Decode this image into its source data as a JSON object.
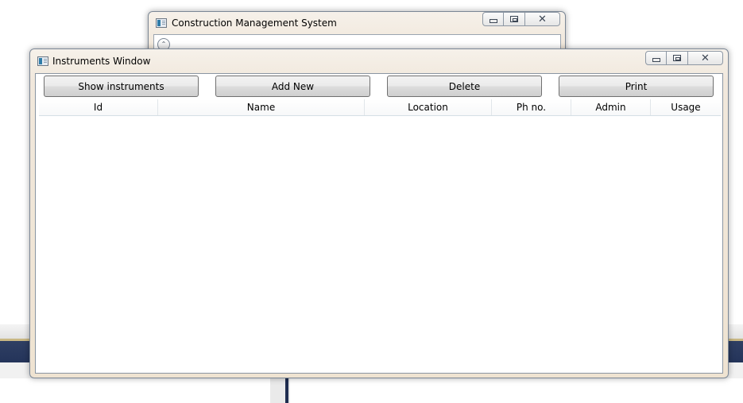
{
  "back_window": {
    "title": "Construction Management System",
    "expander_glyph": "⌃"
  },
  "front_window": {
    "title": "Instruments Window",
    "toolbar": {
      "show_label": "Show instruments",
      "add_label": "Add New",
      "delete_label": "Delete",
      "print_label": "Print"
    },
    "table": {
      "columns": [
        "Id",
        "Name",
        "Location",
        "Ph no.",
        "Admin",
        "Usage"
      ],
      "rows": []
    }
  },
  "caption": {
    "close_glyph": "✕"
  },
  "colors": {
    "taskbar_dark": "#24345a",
    "taskbar_accent": "#c9b884"
  }
}
